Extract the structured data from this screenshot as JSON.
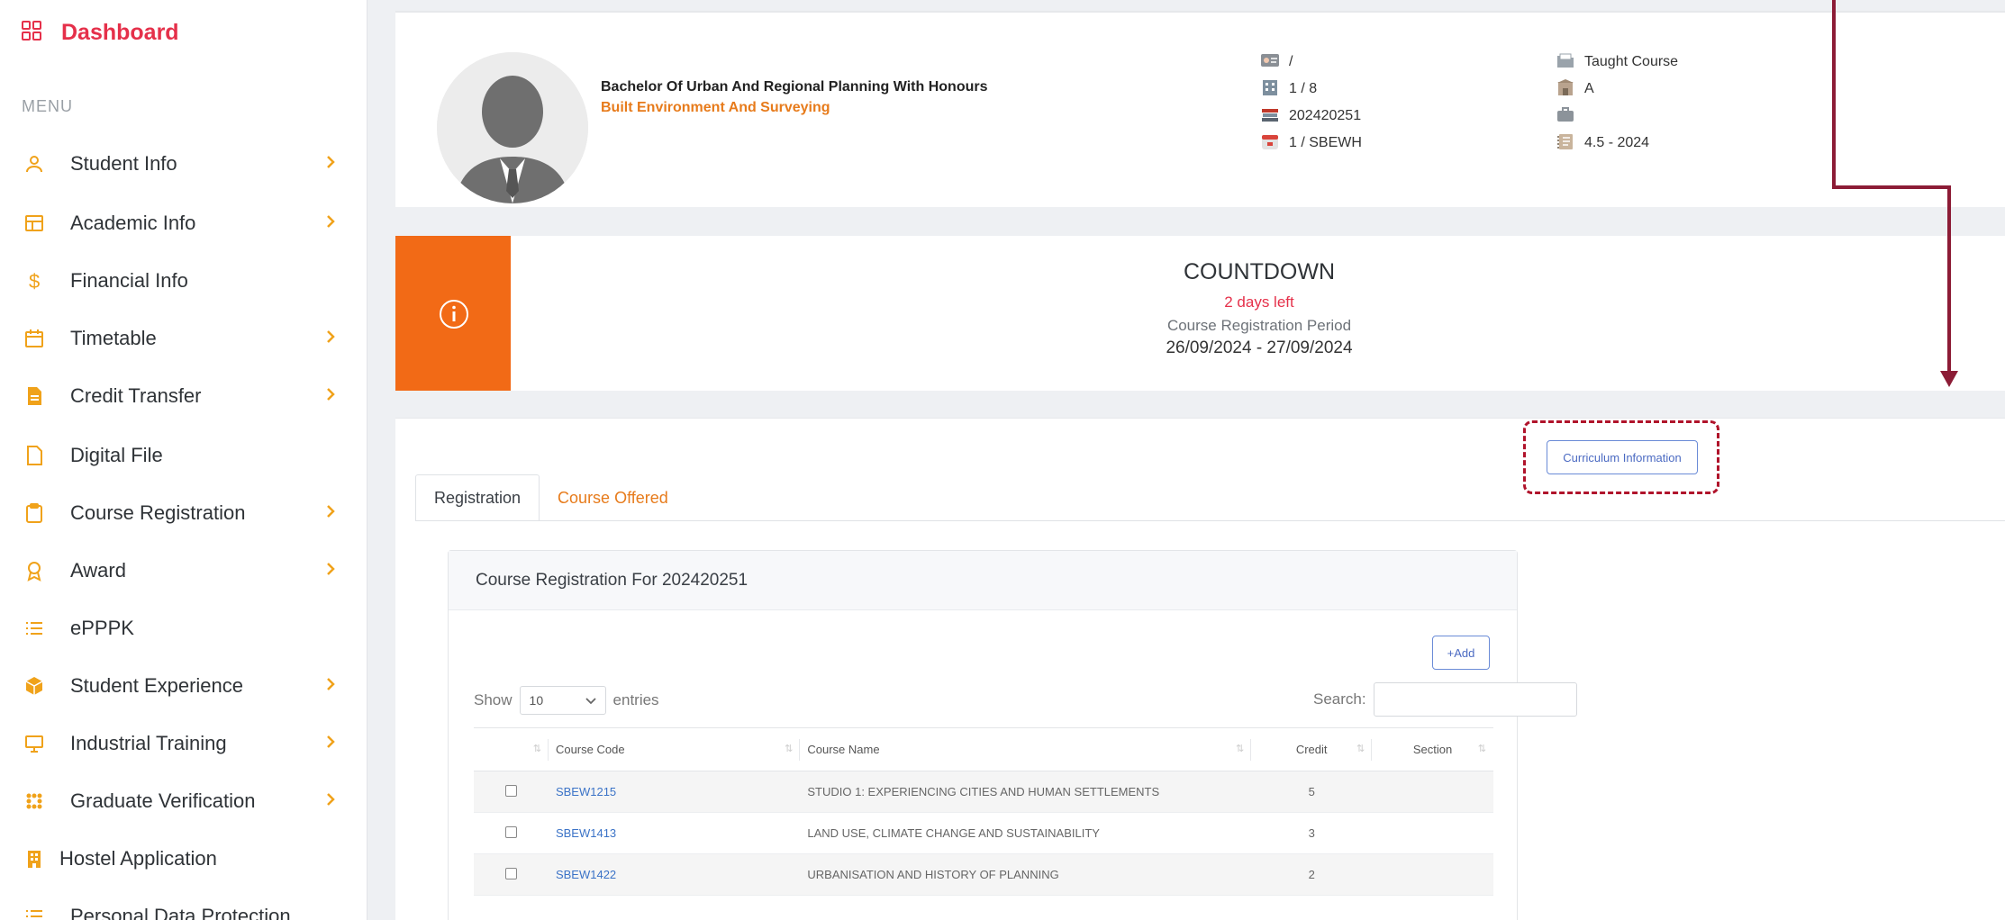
{
  "sidebar": {
    "dashboard": "Dashboard",
    "menu_title": "MENU",
    "items": [
      {
        "label": "Student Info"
      },
      {
        "label": "Academic Info"
      },
      {
        "label": "Financial Info"
      },
      {
        "label": "Timetable"
      },
      {
        "label": "Credit Transfer"
      },
      {
        "label": "Digital File"
      },
      {
        "label": "Course Registration"
      },
      {
        "label": "Award"
      },
      {
        "label": "ePPPK"
      },
      {
        "label": "Student Experience"
      },
      {
        "label": "Industrial Training"
      },
      {
        "label": "Graduate Verification"
      },
      {
        "label": "Hostel Application"
      },
      {
        "label": "Personal Data Protection"
      }
    ]
  },
  "profile": {
    "programme": "Bachelor Of Urban And Regional Planning With Honours",
    "faculty": "Built Environment And Surveying",
    "col1": [
      "/",
      "1 / 8",
      "202420251",
      "1 / SBEWH"
    ],
    "col2": [
      "Taught Course",
      "A",
      "",
      "4.5 - 2024"
    ]
  },
  "countdown": {
    "title": "COUNTDOWN",
    "days_left": "2 days left",
    "period": "Course Registration Period",
    "dates": "26/09/2024 - 27/09/2024"
  },
  "registration": {
    "curriculum_button": "Curriculum Information",
    "tabs": [
      "Registration",
      "Course Offered"
    ],
    "panel_title": "Course Registration For 202420251",
    "add_button": "+Add",
    "show_label": "Show",
    "show_value": "10",
    "entries_label": "entries",
    "search_label": "Search:",
    "columns": [
      "Course Code",
      "Course Name",
      "Credit",
      "Section"
    ],
    "rows": [
      {
        "code": "SBEW1215",
        "name": "STUDIO 1: EXPERIENCING CITIES AND HUMAN SETTLEMENTS",
        "credit": "5",
        "section": ""
      },
      {
        "code": "SBEW1413",
        "name": "LAND USE, CLIMATE CHANGE AND SUSTAINABILITY",
        "credit": "3",
        "section": ""
      },
      {
        "code": "SBEW1422",
        "name": "URBANISATION AND HISTORY OF PLANNING",
        "credit": "2",
        "section": ""
      }
    ]
  },
  "colors": {
    "accent_red": "#e5304a",
    "accent_orange": "#e77b1b",
    "countdown_orange": "#f26a16",
    "annotation_red": "#b0132b",
    "link_blue": "#3b73c7"
  }
}
